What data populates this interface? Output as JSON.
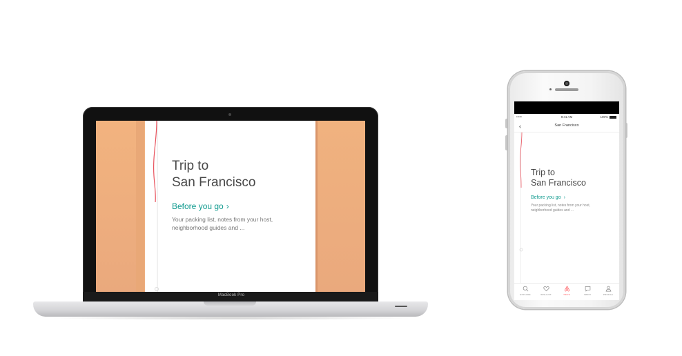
{
  "laptop": {
    "brand_label": "MacBook Pro",
    "screen": {
      "title": "Trip to\nSan Francisco",
      "link_label": "Before you go",
      "link_chevron": "›",
      "description": "Your packing list, notes from your host, neighborhood guides and ..."
    }
  },
  "phone": {
    "status": {
      "carrier": "•••••",
      "time": "9:41 AM",
      "battery": "100%"
    },
    "nav": {
      "back_icon": "chevron-left-icon",
      "back_glyph": "‹",
      "title": "San Francisco"
    },
    "content": {
      "title": "Trip to\nSan Francisco",
      "link_label": "Before you go",
      "link_chevron": "›",
      "description": "Your packing list, notes from your host, neighborhood guides and ..."
    },
    "tabs": [
      {
        "label": "EXPLORE",
        "icon": "search-icon",
        "active": false
      },
      {
        "label": "WISHLIST",
        "icon": "heart-icon",
        "active": false
      },
      {
        "label": "TRIPS",
        "icon": "airbnb-logo-icon",
        "active": true
      },
      {
        "label": "INBOX",
        "icon": "message-icon",
        "active": false
      },
      {
        "label": "PROFILE",
        "icon": "user-icon",
        "active": false
      }
    ]
  },
  "colors": {
    "accent_teal": "#0f9a8e",
    "accent_red": "#ff5a5f",
    "peach": "#f0b27f"
  }
}
